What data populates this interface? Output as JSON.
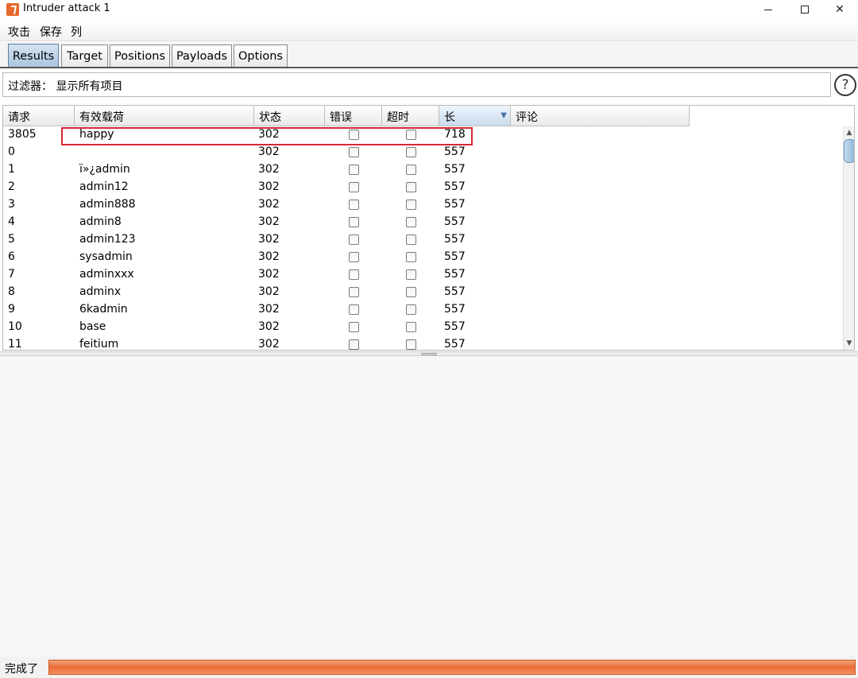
{
  "window": {
    "title": "Intruder attack 1",
    "icon": "burp-icon",
    "controls": {
      "minimize_icon": "minimize-icon",
      "maximize_icon": "maximize-icon",
      "close": "✕"
    }
  },
  "menu": {
    "items": [
      "攻击",
      "保存",
      "列"
    ]
  },
  "tabs": [
    {
      "label": "Results",
      "active": true
    },
    {
      "label": "Target",
      "active": false
    },
    {
      "label": "Positions",
      "active": false
    },
    {
      "label": "Payloads",
      "active": false
    },
    {
      "label": "Options",
      "active": false
    }
  ],
  "filter": {
    "label": "过滤器： 显示所有项目",
    "help": "?"
  },
  "table": {
    "columns": [
      "请求",
      "有效载荷",
      "状态",
      "错误",
      "超时",
      "长",
      "评论"
    ],
    "sorted_column": "长",
    "sort_arrow": "▼",
    "rows": [
      {
        "request": "3805",
        "payload": "happy",
        "status": "302",
        "error": false,
        "timeout": false,
        "length": "718",
        "comment": ""
      },
      {
        "request": "0",
        "payload": "",
        "status": "302",
        "error": false,
        "timeout": false,
        "length": "557",
        "comment": ""
      },
      {
        "request": "1",
        "payload": "ï»¿admin",
        "status": "302",
        "error": false,
        "timeout": false,
        "length": "557",
        "comment": ""
      },
      {
        "request": "2",
        "payload": "admin12",
        "status": "302",
        "error": false,
        "timeout": false,
        "length": "557",
        "comment": ""
      },
      {
        "request": "3",
        "payload": "admin888",
        "status": "302",
        "error": false,
        "timeout": false,
        "length": "557",
        "comment": ""
      },
      {
        "request": "4",
        "payload": "admin8",
        "status": "302",
        "error": false,
        "timeout": false,
        "length": "557",
        "comment": ""
      },
      {
        "request": "5",
        "payload": "admin123",
        "status": "302",
        "error": false,
        "timeout": false,
        "length": "557",
        "comment": ""
      },
      {
        "request": "6",
        "payload": "sysadmin",
        "status": "302",
        "error": false,
        "timeout": false,
        "length": "557",
        "comment": ""
      },
      {
        "request": "7",
        "payload": "adminxxx",
        "status": "302",
        "error": false,
        "timeout": false,
        "length": "557",
        "comment": ""
      },
      {
        "request": "8",
        "payload": "adminx",
        "status": "302",
        "error": false,
        "timeout": false,
        "length": "557",
        "comment": ""
      },
      {
        "request": "9",
        "payload": "6kadmin",
        "status": "302",
        "error": false,
        "timeout": false,
        "length": "557",
        "comment": ""
      },
      {
        "request": "10",
        "payload": "base",
        "status": "302",
        "error": false,
        "timeout": false,
        "length": "557",
        "comment": ""
      },
      {
        "request": "11",
        "payload": "feitium",
        "status": "302",
        "error": false,
        "timeout": false,
        "length": "557",
        "comment": ""
      }
    ],
    "highlighted_row": 0,
    "highlight_color": "#d42a34"
  },
  "status": {
    "text": "完成了",
    "progress": 1.0,
    "progress_color": "#ea6a35"
  },
  "colors": {
    "active_tab": "#a9c4de",
    "sorted_header": "#c9dcee"
  }
}
